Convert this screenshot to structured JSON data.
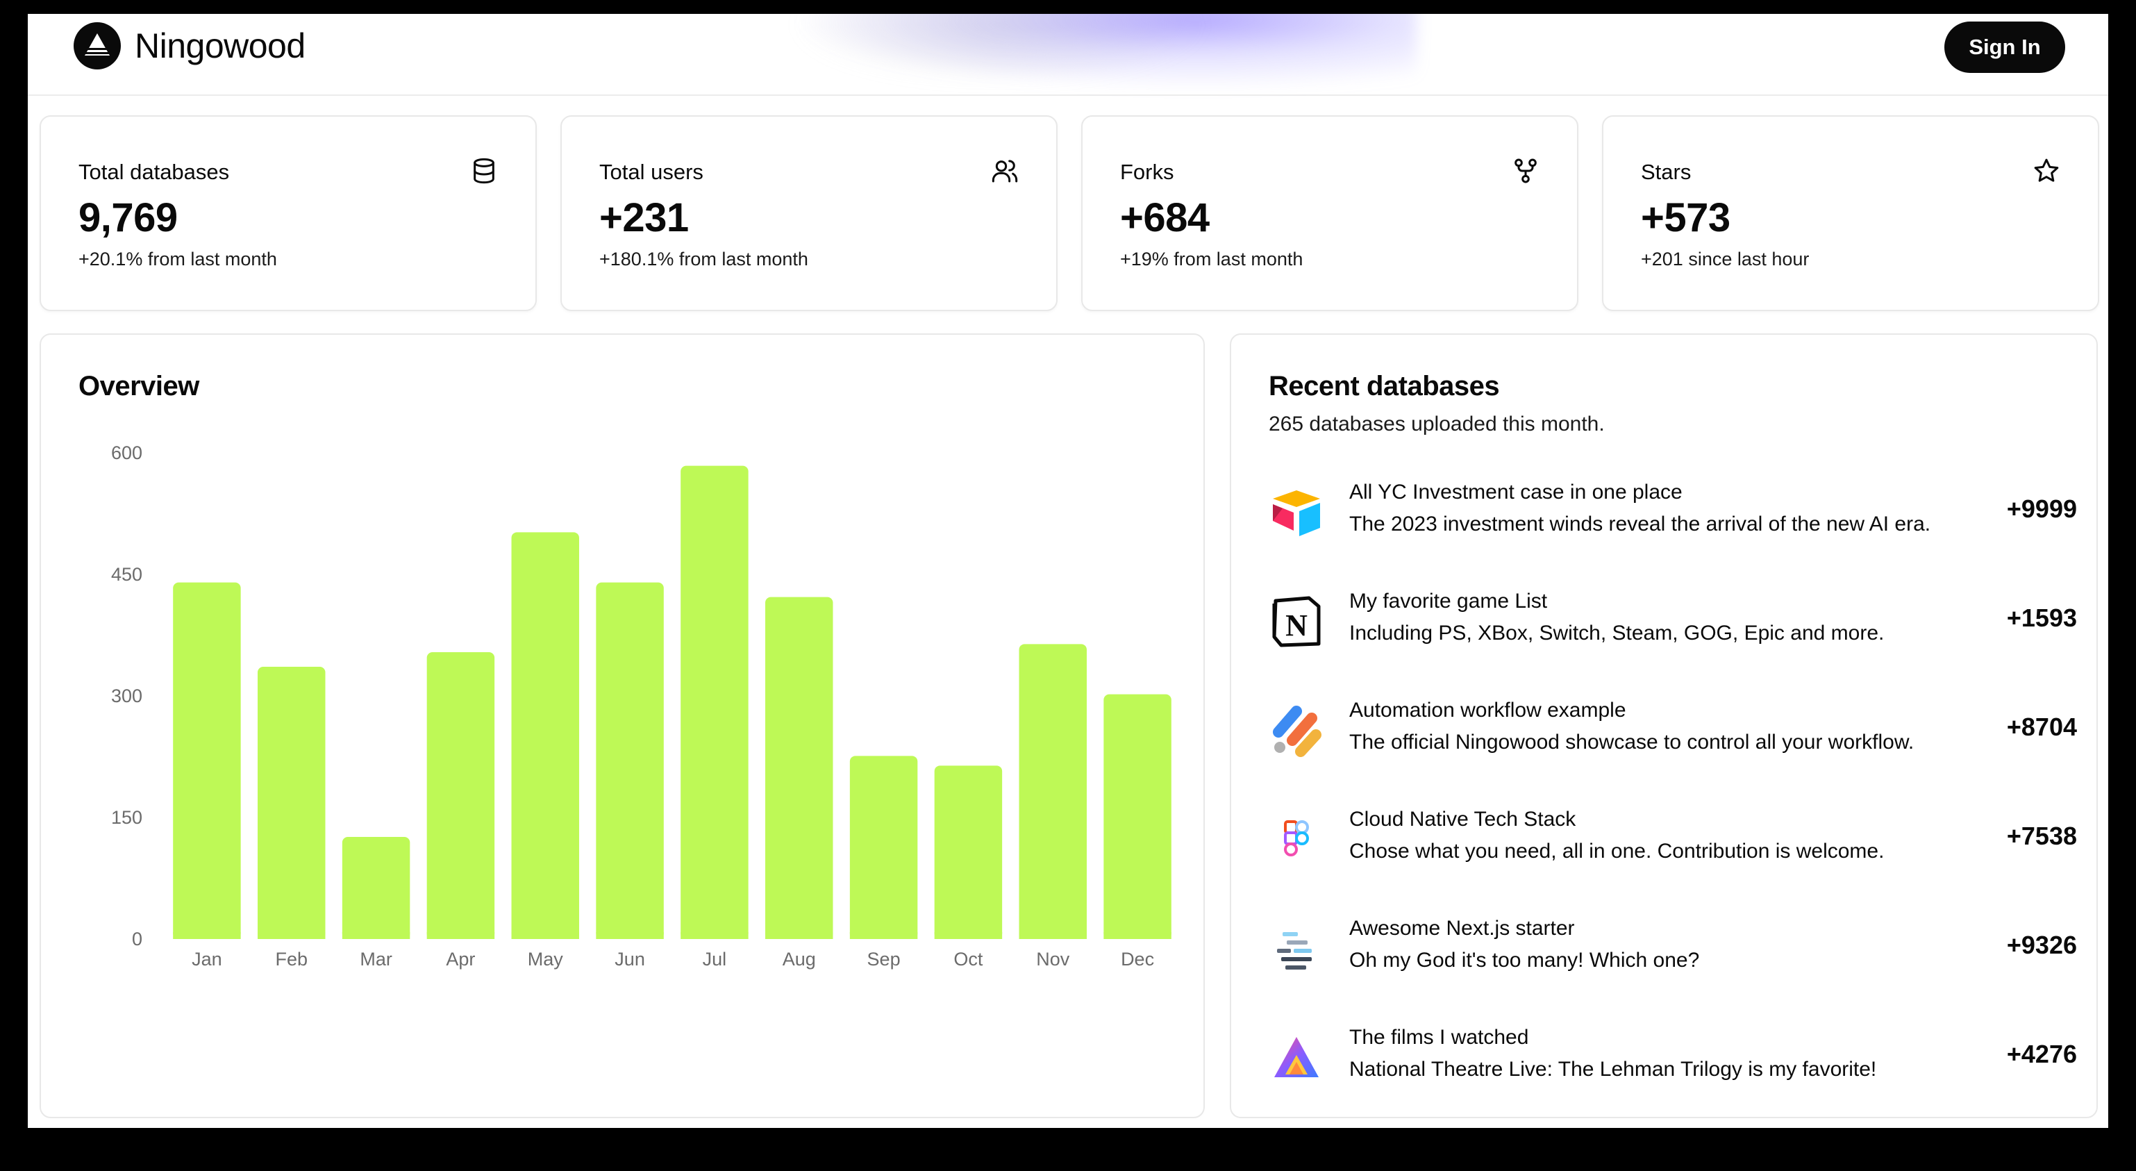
{
  "header": {
    "brand": "Ningowood",
    "sign_in_label": "Sign In"
  },
  "stats": [
    {
      "title": "Total databases",
      "value": "9,769",
      "sub": "+20.1% from last month",
      "icon": "database-icon"
    },
    {
      "title": "Total users",
      "value": "+231",
      "sub": "+180.1% from last month",
      "icon": "users-icon"
    },
    {
      "title": "Forks",
      "value": "+684",
      "sub": "+19% from last month",
      "icon": "fork-icon"
    },
    {
      "title": "Stars",
      "value": "+573",
      "sub": "+201 since last hour",
      "icon": "star-icon"
    }
  ],
  "overview": {
    "title": "Overview"
  },
  "chart_data": {
    "type": "bar",
    "title": "Overview",
    "categories": [
      "Jan",
      "Feb",
      "Mar",
      "Apr",
      "May",
      "Jun",
      "Jul",
      "Aug",
      "Sep",
      "Oct",
      "Nov",
      "Dec"
    ],
    "values": [
      440,
      336,
      126,
      354,
      502,
      440,
      584,
      422,
      226,
      214,
      364,
      302
    ],
    "yticks": [
      0,
      150,
      300,
      450,
      600
    ],
    "ylim": [
      0,
      600
    ],
    "grid": false,
    "bar_color": "#bef956"
  },
  "recent": {
    "title": "Recent databases",
    "subtitle": "265 databases uploaded this month.",
    "items": [
      {
        "name": "All YC Investment case in one place",
        "desc": "The 2023 investment winds reveal the arrival of the new AI era.",
        "amount": "+9999",
        "logo": "airtable-logo-icon"
      },
      {
        "name": "My favorite game List",
        "desc": "Including PS, XBox, Switch, Steam, GOG, Epic and more.",
        "amount": "+1593",
        "logo": "notion-logo-icon"
      },
      {
        "name": "Automation workflow example",
        "desc": "The official Ningowood showcase to control all your workflow.",
        "amount": "+8704",
        "logo": "zapier-logo-icon"
      },
      {
        "name": "Cloud Native Tech Stack",
        "desc": "Chose what you need, all in one. Contribution is welcome.",
        "amount": "+7538",
        "logo": "figma-logo-icon"
      },
      {
        "name": "Awesome Next.js starter",
        "desc": "Oh my God it's too many! Which one?",
        "amount": "+9326",
        "logo": "stack-logo-icon"
      },
      {
        "name": "The films I watched",
        "desc": "National Theatre Live: The Lehman Trilogy is my favorite!",
        "amount": "+4276",
        "logo": "triangle-logo-icon"
      }
    ]
  }
}
